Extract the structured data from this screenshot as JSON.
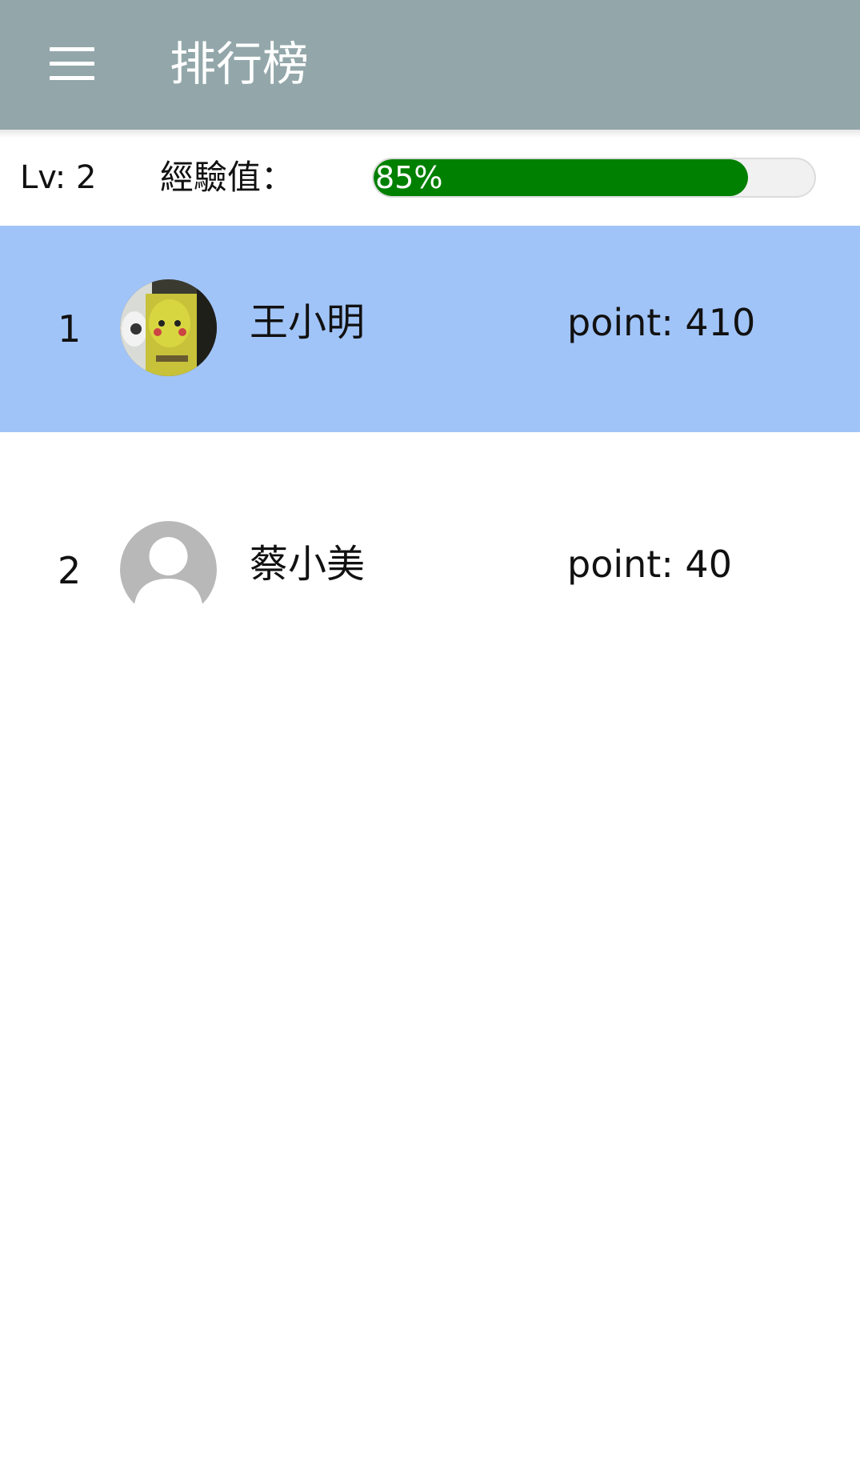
{
  "appbar": {
    "title": "排行榜",
    "menu_icon": "hamburger-menu-icon",
    "background": "#93a7aa"
  },
  "status": {
    "level": "Lv: 2",
    "exp_label": "經驗值：",
    "exp_percent_text": "85%",
    "exp_progress": 0.85,
    "progress_color": "#008000"
  },
  "leaderboard": [
    {
      "rank": "1",
      "name": "王小明",
      "points": "point: 410",
      "avatar": "photo-avatar-icon",
      "highlighted": true
    },
    {
      "rank": "2",
      "name": "蔡小美",
      "points": "point: 40",
      "avatar": "default-person-icon",
      "highlighted": false
    }
  ],
  "colors": {
    "highlight_row": "#a1c4f8"
  }
}
